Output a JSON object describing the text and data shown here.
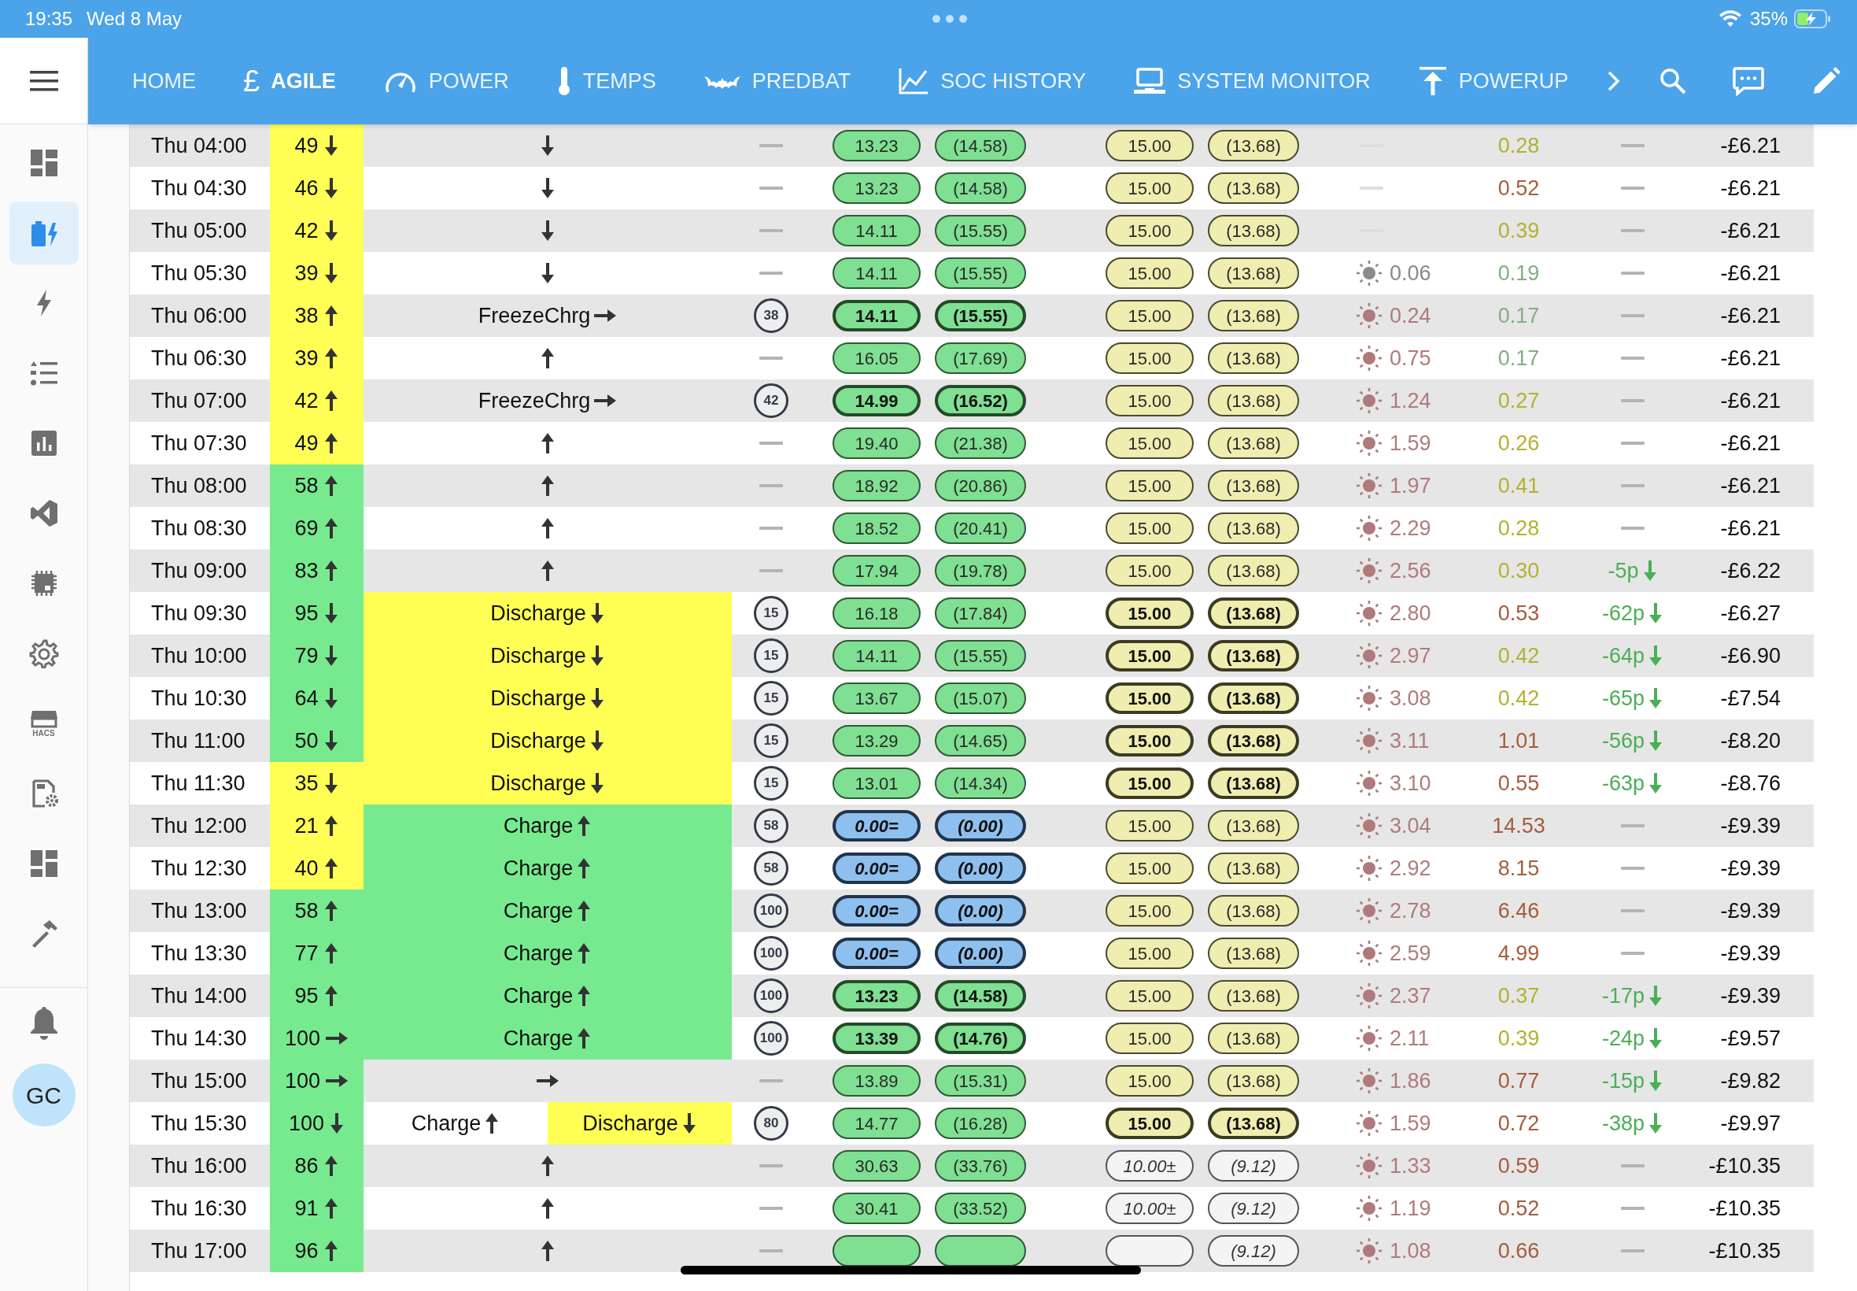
{
  "status_bar": {
    "time": "19:35",
    "date": "Wed 8 May",
    "battery": "35%"
  },
  "nav": {
    "tabs": [
      {
        "label": "HOME",
        "selected": false
      },
      {
        "label": "AGILE",
        "selected": true,
        "glyph": "£"
      },
      {
        "label": "POWER",
        "selected": false
      },
      {
        "label": "TEMPS",
        "selected": false
      },
      {
        "label": "PREDBAT",
        "selected": false
      },
      {
        "label": "SOC HISTORY",
        "selected": false
      },
      {
        "label": "SYSTEM MONITOR",
        "selected": false
      },
      {
        "label": "POWERUP",
        "selected": false
      }
    ]
  },
  "sidebar": {
    "items": [
      {
        "selected": false
      },
      {
        "selected": true
      },
      {
        "selected": false
      },
      {
        "selected": false
      },
      {
        "selected": false
      },
      {
        "selected": false
      },
      {
        "selected": false
      },
      {
        "selected": false
      },
      {
        "selected": false,
        "caption": "HACS"
      },
      {
        "selected": false
      },
      {
        "selected": false
      },
      {
        "selected": false
      }
    ],
    "avatar": "GC"
  },
  "rows": [
    {
      "time": "Thu 04:00",
      "soc": {
        "text": "49",
        "kind": "down",
        "color": "#ffff55"
      },
      "state": [
        {
          "kind": "down"
        }
      ],
      "import": {
        "kind": "normal",
        "text": "13.23"
      },
      "import_net": {
        "kind": "normal",
        "text": "(14.58)"
      },
      "export": {
        "kind": "normal",
        "text": "15.00"
      },
      "export_net": {
        "kind": "normal",
        "text": "(13.68)"
      },
      "load": {
        "text": "0.28",
        "color": "#b3b12e"
      },
      "total": "-£6.21"
    },
    {
      "time": "Thu 04:30",
      "soc": {
        "text": "46",
        "kind": "down",
        "color": "#ffff55"
      },
      "state": [
        {
          "kind": "down"
        }
      ],
      "import": {
        "kind": "normal",
        "text": "13.23"
      },
      "import_net": {
        "kind": "normal",
        "text": "(14.58)"
      },
      "export": {
        "kind": "normal",
        "text": "15.00"
      },
      "export_net": {
        "kind": "normal",
        "text": "(13.68)"
      },
      "load": {
        "text": "0.52",
        "color": "#a65c3c"
      },
      "total": "-£6.21"
    },
    {
      "time": "Thu 05:00",
      "soc": {
        "text": "42",
        "kind": "down",
        "color": "#ffff55"
      },
      "state": [
        {
          "kind": "down"
        }
      ],
      "import": {
        "kind": "normal",
        "text": "14.11"
      },
      "import_net": {
        "kind": "normal",
        "text": "(15.55)"
      },
      "export": {
        "kind": "normal",
        "text": "15.00"
      },
      "export_net": {
        "kind": "normal",
        "text": "(13.68)"
      },
      "load": {
        "text": "0.39",
        "color": "#b3b12e"
      },
      "total": "-£6.21"
    },
    {
      "time": "Thu 05:30",
      "soc": {
        "text": "39",
        "kind": "down",
        "color": "#ffff55"
      },
      "state": [
        {
          "kind": "down"
        }
      ],
      "import": {
        "kind": "normal",
        "text": "14.11"
      },
      "import_net": {
        "kind": "normal",
        "text": "(15.55)"
      },
      "export": {
        "kind": "normal",
        "text": "15.00"
      },
      "export_net": {
        "kind": "normal",
        "text": "(13.68)"
      },
      "pv": {
        "text": "0.06",
        "color": "#8a8a8a"
      },
      "load": {
        "text": "0.19",
        "color": "#7fb07f"
      },
      "total": "-£6.21"
    },
    {
      "time": "Thu 06:00",
      "soc": {
        "text": "38",
        "kind": "up",
        "color": "#ffff55"
      },
      "state": [
        {
          "label": "FreezeChrg",
          "kind": "right"
        }
      ],
      "limit": "38",
      "import": {
        "kind": "bold",
        "text": "14.11"
      },
      "import_net": {
        "kind": "bold",
        "text": "(15.55)"
      },
      "export": {
        "kind": "normal",
        "text": "15.00"
      },
      "export_net": {
        "kind": "normal",
        "text": "(13.68)"
      },
      "pv": {
        "text": "0.24",
        "color": "#b07a7a"
      },
      "load": {
        "text": "0.17",
        "color": "#7fb07f"
      },
      "total": "-£6.21"
    },
    {
      "time": "Thu 06:30",
      "soc": {
        "text": "39",
        "kind": "up",
        "color": "#ffff55"
      },
      "state": [
        {
          "kind": "up"
        }
      ],
      "import": {
        "kind": "normal",
        "text": "16.05"
      },
      "import_net": {
        "kind": "normal",
        "text": "(17.69)"
      },
      "export": {
        "kind": "normal",
        "text": "15.00"
      },
      "export_net": {
        "kind": "normal",
        "text": "(13.68)"
      },
      "pv": {
        "text": "0.75",
        "color": "#b07a7a"
      },
      "load": {
        "text": "0.17",
        "color": "#7fb07f"
      },
      "total": "-£6.21"
    },
    {
      "time": "Thu 07:00",
      "soc": {
        "text": "42",
        "kind": "up",
        "color": "#ffff55"
      },
      "state": [
        {
          "label": "FreezeChrg",
          "kind": "right"
        }
      ],
      "limit": "42",
      "import": {
        "kind": "bold",
        "text": "14.99"
      },
      "import_net": {
        "kind": "bold",
        "text": "(16.52)"
      },
      "export": {
        "kind": "normal",
        "text": "15.00"
      },
      "export_net": {
        "kind": "normal",
        "text": "(13.68)"
      },
      "pv": {
        "text": "1.24",
        "color": "#b07a7a"
      },
      "load": {
        "text": "0.27",
        "color": "#b3b12e"
      },
      "total": "-£6.21"
    },
    {
      "time": "Thu 07:30",
      "soc": {
        "text": "49",
        "kind": "up",
        "color": "#ffff55"
      },
      "state": [
        {
          "kind": "up"
        }
      ],
      "import": {
        "kind": "normal",
        "text": "19.40"
      },
      "import_net": {
        "kind": "normal",
        "text": "(21.38)"
      },
      "export": {
        "kind": "normal",
        "text": "15.00"
      },
      "export_net": {
        "kind": "normal",
        "text": "(13.68)"
      },
      "pv": {
        "text": "1.59",
        "color": "#b07a7a"
      },
      "load": {
        "text": "0.26",
        "color": "#b3b12e"
      },
      "total": "-£6.21"
    },
    {
      "time": "Thu 08:00",
      "soc": {
        "text": "58",
        "kind": "up",
        "color": "#77ea8f"
      },
      "state": [
        {
          "kind": "up"
        }
      ],
      "import": {
        "kind": "normal",
        "text": "18.92"
      },
      "import_net": {
        "kind": "normal",
        "text": "(20.86)"
      },
      "export": {
        "kind": "normal",
        "text": "15.00"
      },
      "export_net": {
        "kind": "normal",
        "text": "(13.68)"
      },
      "pv": {
        "text": "1.97",
        "color": "#b07a7a"
      },
      "load": {
        "text": "0.41",
        "color": "#b3b12e"
      },
      "total": "-£6.21"
    },
    {
      "time": "Thu 08:30",
      "soc": {
        "text": "69",
        "kind": "up",
        "color": "#77ea8f"
      },
      "state": [
        {
          "kind": "up"
        }
      ],
      "import": {
        "kind": "normal",
        "text": "18.52"
      },
      "import_net": {
        "kind": "normal",
        "text": "(20.41)"
      },
      "export": {
        "kind": "normal",
        "text": "15.00"
      },
      "export_net": {
        "kind": "normal",
        "text": "(13.68)"
      },
      "pv": {
        "text": "2.29",
        "color": "#b07a7a"
      },
      "load": {
        "text": "0.28",
        "color": "#b3b12e"
      },
      "total": "-£6.21"
    },
    {
      "time": "Thu 09:00",
      "soc": {
        "text": "83",
        "kind": "up",
        "color": "#77ea8f"
      },
      "state": [
        {
          "kind": "up"
        }
      ],
      "import": {
        "kind": "normal",
        "text": "17.94"
      },
      "import_net": {
        "kind": "normal",
        "text": "(19.78)"
      },
      "export": {
        "kind": "normal",
        "text": "15.00"
      },
      "export_net": {
        "kind": "normal",
        "text": "(13.68)"
      },
      "pv": {
        "text": "2.56",
        "color": "#b07a7a"
      },
      "load": {
        "text": "0.30",
        "color": "#b3b12e"
      },
      "cost": {
        "text": "-5p",
        "kind": "down"
      },
      "total": "-£6.22"
    },
    {
      "time": "Thu 09:30",
      "soc": {
        "text": "95",
        "kind": "down",
        "color": "#77ea8f"
      },
      "state": [
        {
          "label": "Discharge",
          "kind": "down",
          "color": "#ffff55"
        }
      ],
      "limit": "15",
      "import": {
        "kind": "normal",
        "text": "16.18"
      },
      "import_net": {
        "kind": "normal",
        "text": "(17.84)"
      },
      "export": {
        "kind": "bold",
        "text": "15.00"
      },
      "export_net": {
        "kind": "bold",
        "text": "(13.68)"
      },
      "pv": {
        "text": "2.80",
        "color": "#b07a7a"
      },
      "load": {
        "text": "0.53",
        "color": "#a65c3c"
      },
      "cost": {
        "text": "-62p",
        "kind": "down"
      },
      "total": "-£6.27"
    },
    {
      "time": "Thu 10:00",
      "soc": {
        "text": "79",
        "kind": "down",
        "color": "#77ea8f"
      },
      "state": [
        {
          "label": "Discharge",
          "kind": "down",
          "color": "#ffff55"
        }
      ],
      "limit": "15",
      "import": {
        "kind": "normal",
        "text": "14.11"
      },
      "import_net": {
        "kind": "normal",
        "text": "(15.55)"
      },
      "export": {
        "kind": "bold",
        "text": "15.00"
      },
      "export_net": {
        "kind": "bold",
        "text": "(13.68)"
      },
      "pv": {
        "text": "2.97",
        "color": "#b07a7a"
      },
      "load": {
        "text": "0.42",
        "color": "#b3b12e"
      },
      "cost": {
        "text": "-64p",
        "kind": "down"
      },
      "total": "-£6.90"
    },
    {
      "time": "Thu 10:30",
      "soc": {
        "text": "64",
        "kind": "down",
        "color": "#77ea8f"
      },
      "state": [
        {
          "label": "Discharge",
          "kind": "down",
          "color": "#ffff55"
        }
      ],
      "limit": "15",
      "import": {
        "kind": "normal",
        "text": "13.67"
      },
      "import_net": {
        "kind": "normal",
        "text": "(15.07)"
      },
      "export": {
        "kind": "bold",
        "text": "15.00"
      },
      "export_net": {
        "kind": "bold",
        "text": "(13.68)"
      },
      "pv": {
        "text": "3.08",
        "color": "#b07a7a"
      },
      "load": {
        "text": "0.42",
        "color": "#b3b12e"
      },
      "cost": {
        "text": "-65p",
        "kind": "down"
      },
      "total": "-£7.54"
    },
    {
      "time": "Thu 11:00",
      "soc": {
        "text": "50",
        "kind": "down",
        "color": "#77ea8f"
      },
      "state": [
        {
          "label": "Discharge",
          "kind": "down",
          "color": "#ffff55"
        }
      ],
      "limit": "15",
      "import": {
        "kind": "normal",
        "text": "13.29"
      },
      "import_net": {
        "kind": "normal",
        "text": "(14.65)"
      },
      "export": {
        "kind": "bold",
        "text": "15.00"
      },
      "export_net": {
        "kind": "bold",
        "text": "(13.68)"
      },
      "pv": {
        "text": "3.11",
        "color": "#b07a7a"
      },
      "load": {
        "text": "1.01",
        "color": "#a65c3c"
      },
      "cost": {
        "text": "-56p",
        "kind": "down"
      },
      "total": "-£8.20"
    },
    {
      "time": "Thu 11:30",
      "soc": {
        "text": "35",
        "kind": "down",
        "color": "#ffff55"
      },
      "state": [
        {
          "label": "Discharge",
          "kind": "down",
          "color": "#ffff55"
        }
      ],
      "limit": "15",
      "import": {
        "kind": "normal",
        "text": "13.01"
      },
      "import_net": {
        "kind": "normal",
        "text": "(14.34)"
      },
      "export": {
        "kind": "bold",
        "text": "15.00"
      },
      "export_net": {
        "kind": "bold",
        "text": "(13.68)"
      },
      "pv": {
        "text": "3.10",
        "color": "#b07a7a"
      },
      "load": {
        "text": "0.55",
        "color": "#a65c3c"
      },
      "cost": {
        "text": "-63p",
        "kind": "down"
      },
      "total": "-£8.76"
    },
    {
      "time": "Thu 12:00",
      "soc": {
        "text": "21",
        "kind": "up",
        "color": "#ffff55"
      },
      "state": [
        {
          "label": "Charge",
          "kind": "up",
          "color": "#77ea8f"
        }
      ],
      "limit": "58",
      "import": {
        "kind": "blue",
        "text": "0.00="
      },
      "import_net": {
        "kind": "blue",
        "text": "(0.00)"
      },
      "export": {
        "kind": "normal",
        "text": "15.00"
      },
      "export_net": {
        "kind": "normal",
        "text": "(13.68)"
      },
      "pv": {
        "text": "3.04",
        "color": "#b07a7a"
      },
      "load": {
        "text": "14.53",
        "color": "#a65c3c"
      },
      "total": "-£9.39"
    },
    {
      "time": "Thu 12:30",
      "soc": {
        "text": "40",
        "kind": "up",
        "color": "#ffff55"
      },
      "state": [
        {
          "label": "Charge",
          "kind": "up",
          "color": "#77ea8f"
        }
      ],
      "limit": "58",
      "import": {
        "kind": "blue",
        "text": "0.00="
      },
      "import_net": {
        "kind": "blue",
        "text": "(0.00)"
      },
      "export": {
        "kind": "normal",
        "text": "15.00"
      },
      "export_net": {
        "kind": "normal",
        "text": "(13.68)"
      },
      "pv": {
        "text": "2.92",
        "color": "#b07a7a"
      },
      "load": {
        "text": "8.15",
        "color": "#a65c3c"
      },
      "total": "-£9.39"
    },
    {
      "time": "Thu 13:00",
      "soc": {
        "text": "58",
        "kind": "up",
        "color": "#77ea8f"
      },
      "state": [
        {
          "label": "Charge",
          "kind": "up",
          "color": "#77ea8f"
        }
      ],
      "limit": "100",
      "import": {
        "kind": "blue",
        "text": "0.00="
      },
      "import_net": {
        "kind": "blue",
        "text": "(0.00)"
      },
      "export": {
        "kind": "normal",
        "text": "15.00"
      },
      "export_net": {
        "kind": "normal",
        "text": "(13.68)"
      },
      "pv": {
        "text": "2.78",
        "color": "#b07a7a"
      },
      "load": {
        "text": "6.46",
        "color": "#a65c3c"
      },
      "total": "-£9.39"
    },
    {
      "time": "Thu 13:30",
      "soc": {
        "text": "77",
        "kind": "up",
        "color": "#77ea8f"
      },
      "state": [
        {
          "label": "Charge",
          "kind": "up",
          "color": "#77ea8f"
        }
      ],
      "limit": "100",
      "import": {
        "kind": "blue",
        "text": "0.00="
      },
      "import_net": {
        "kind": "blue",
        "text": "(0.00)"
      },
      "export": {
        "kind": "normal",
        "text": "15.00"
      },
      "export_net": {
        "kind": "normal",
        "text": "(13.68)"
      },
      "pv": {
        "text": "2.59",
        "color": "#b07a7a"
      },
      "load": {
        "text": "4.99",
        "color": "#a65c3c"
      },
      "total": "-£9.39"
    },
    {
      "time": "Thu 14:00",
      "soc": {
        "text": "95",
        "kind": "up",
        "color": "#77ea8f"
      },
      "state": [
        {
          "label": "Charge",
          "kind": "up",
          "color": "#77ea8f"
        }
      ],
      "limit": "100",
      "import": {
        "kind": "bold",
        "text": "13.23"
      },
      "import_net": {
        "kind": "bold",
        "text": "(14.58)"
      },
      "export": {
        "kind": "normal",
        "text": "15.00"
      },
      "export_net": {
        "kind": "normal",
        "text": "(13.68)"
      },
      "pv": {
        "text": "2.37",
        "color": "#b07a7a"
      },
      "load": {
        "text": "0.37",
        "color": "#b3b12e"
      },
      "cost": {
        "text": "-17p",
        "kind": "down"
      },
      "total": "-£9.39"
    },
    {
      "time": "Thu 14:30",
      "soc": {
        "text": "100",
        "kind": "right",
        "color": "#77ea8f"
      },
      "state": [
        {
          "label": "Charge",
          "kind": "up",
          "color": "#77ea8f"
        }
      ],
      "limit": "100",
      "import": {
        "kind": "bold",
        "text": "13.39"
      },
      "import_net": {
        "kind": "bold",
        "text": "(14.76)"
      },
      "export": {
        "kind": "normal",
        "text": "15.00"
      },
      "export_net": {
        "kind": "normal",
        "text": "(13.68)"
      },
      "pv": {
        "text": "2.11",
        "color": "#b07a7a"
      },
      "load": {
        "text": "0.39",
        "color": "#b3b12e"
      },
      "cost": {
        "text": "-24p",
        "kind": "down"
      },
      "total": "-£9.57"
    },
    {
      "time": "Thu 15:00",
      "soc": {
        "text": "100",
        "kind": "right",
        "color": "#77ea8f"
      },
      "state": [
        {
          "kind": "right"
        }
      ],
      "import": {
        "kind": "normal",
        "text": "13.89"
      },
      "import_net": {
        "kind": "normal",
        "text": "(15.31)"
      },
      "export": {
        "kind": "normal",
        "text": "15.00"
      },
      "export_net": {
        "kind": "normal",
        "text": "(13.68)"
      },
      "pv": {
        "text": "1.86",
        "color": "#b07a7a"
      },
      "load": {
        "text": "0.77",
        "color": "#a65c3c"
      },
      "cost": {
        "text": "-15p",
        "kind": "down"
      },
      "total": "-£9.82"
    },
    {
      "time": "Thu 15:30",
      "soc": {
        "text": "100",
        "kind": "down",
        "color": "#77ea8f"
      },
      "state": [
        {
          "label": "Charge",
          "kind": "up"
        },
        {
          "label": "Discharge",
          "kind": "down",
          "color": "#ffff55"
        }
      ],
      "limit": "80",
      "import": {
        "kind": "normal",
        "text": "14.77"
      },
      "import_net": {
        "kind": "normal",
        "text": "(16.28)"
      },
      "export": {
        "kind": "bold",
        "text": "15.00"
      },
      "export_net": {
        "kind": "bold",
        "text": "(13.68)"
      },
      "pv": {
        "text": "1.59",
        "color": "#b07a7a"
      },
      "load": {
        "text": "0.72",
        "color": "#a65c3c"
      },
      "cost": {
        "text": "-38p",
        "kind": "down"
      },
      "total": "-£9.97"
    },
    {
      "time": "Thu 16:00",
      "soc": {
        "text": "86",
        "kind": "up",
        "color": "#77ea8f"
      },
      "state": [
        {
          "kind": "up"
        }
      ],
      "import": {
        "kind": "normal",
        "text": "30.63"
      },
      "import_net": {
        "kind": "normal",
        "text": "(33.76)"
      },
      "export": {
        "kind": "grey",
        "text": "10.00±"
      },
      "export_net": {
        "kind": "grey",
        "text": "(9.12)"
      },
      "pv": {
        "text": "1.33",
        "color": "#b07a7a"
      },
      "load": {
        "text": "0.59",
        "color": "#a65c3c"
      },
      "total": "-£10.35"
    },
    {
      "time": "Thu 16:30",
      "soc": {
        "text": "91",
        "kind": "up",
        "color": "#77ea8f"
      },
      "state": [
        {
          "kind": "up"
        }
      ],
      "import": {
        "kind": "normal",
        "text": "30.41"
      },
      "import_net": {
        "kind": "normal",
        "text": "(33.52)"
      },
      "export": {
        "kind": "grey",
        "text": "10.00±"
      },
      "export_net": {
        "kind": "grey",
        "text": "(9.12)"
      },
      "pv": {
        "text": "1.19",
        "color": "#b07a7a"
      },
      "load": {
        "text": "0.52",
        "color": "#a65c3c"
      },
      "total": "-£10.35"
    },
    {
      "time": "Thu 17:00",
      "soc": {
        "text": "96",
        "kind": "up",
        "color": "#77ea8f"
      },
      "state": [
        {
          "kind": "up"
        }
      ],
      "import": {
        "kind": "normal"
      },
      "import_net": {
        "kind": "normal"
      },
      "export": {
        "kind": "grey"
      },
      "export_net": {
        "kind": "grey",
        "text": "(9.12)"
      },
      "pv": {
        "text": "1.08",
        "color": "#b07a7a"
      },
      "load": {
        "text": "0.66",
        "color": "#a65c3c"
      },
      "total": "-£10.35"
    }
  ]
}
